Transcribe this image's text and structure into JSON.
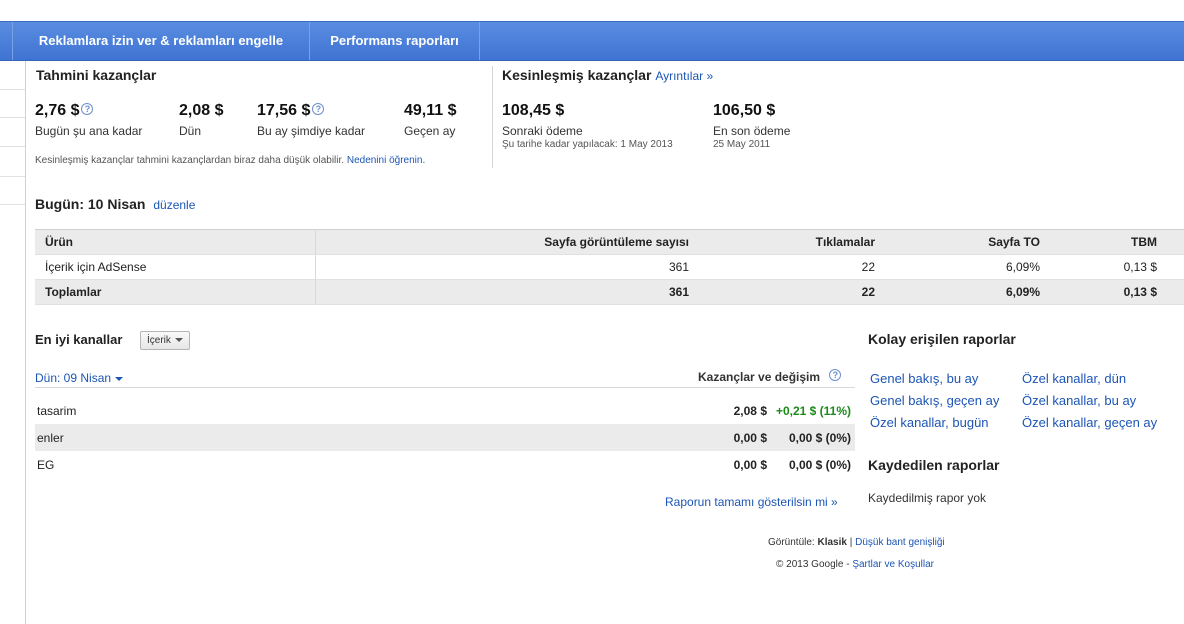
{
  "nav": {
    "tab1": "Reklamlara izin ver & reklamları engelle",
    "tab2": "Performans raporları"
  },
  "estimated": {
    "title": "Tahmini kazançlar",
    "items": [
      {
        "value": "2,76 $",
        "label": "Bugün şu ana kadar"
      },
      {
        "value": "2,08 $",
        "label": "Dün"
      },
      {
        "value": "17,56 $",
        "label": "Bu ay şimdiye kadar"
      },
      {
        "value": "49,11 $",
        "label": "Geçen ay"
      }
    ],
    "note": "Kesinleşmiş kazançlar tahmini kazançlardan biraz daha düşük olabilir.",
    "note_link": "Nedenini öğrenin."
  },
  "finalized": {
    "title": "Kesinleşmiş kazançlar",
    "details_link": "Ayrıntılar »",
    "next": {
      "value": "108,45 $",
      "label": "Sonraki ödeme",
      "note": "Şu tarihe kadar yapılacak: 1 May 2013"
    },
    "last": {
      "value": "106,50 $",
      "label": "En son ödeme",
      "note": "25 May 2011"
    }
  },
  "today": {
    "title": "Bugün: 10 Nisan",
    "edit_link": "düzenle"
  },
  "table": {
    "headers": [
      "Ürün",
      "Sayfa görüntüleme sayısı",
      "Tıklamalar",
      "Sayfa TO",
      "TBM"
    ],
    "rows": [
      [
        "İçerik için AdSense",
        "361",
        "22",
        "6,09%",
        "0,13 $"
      ]
    ],
    "totals": [
      "Toplamlar",
      "361",
      "22",
      "6,09%",
      "0,13 $"
    ]
  },
  "channels": {
    "title": "En iyi kanallar",
    "dropdown": "İçerik",
    "date_link": "Dün: 09 Nisan",
    "column_header": "Kazançlar ve değişim",
    "rows": [
      {
        "name": "tasarim",
        "amount": "2,08 $",
        "change": "+0,21 $ (11%)"
      },
      {
        "name": "enler",
        "amount": "0,00 $",
        "change": "0,00 $ (0%)"
      },
      {
        "name": "EG",
        "amount": "0,00 $",
        "change": "0,00 $ (0%)"
      }
    ],
    "full_report_link": "Raporun tamamı gösterilsin mi »"
  },
  "quick_reports": {
    "title": "Kolay erişilen raporlar",
    "links": [
      "Genel bakış, bu ay",
      "Özel kanallar, dün",
      "Genel bakış, geçen ay",
      "Özel kanallar, bu ay",
      "Özel kanallar, bugün",
      "Özel kanallar, geçen ay"
    ]
  },
  "saved_reports": {
    "title": "Kaydedilen raporlar",
    "empty": "Kaydedilmiş rapor yok"
  },
  "footer": {
    "view_label": "Görüntüle:",
    "view_current": "Klasik",
    "separator": "|",
    "view_alt": "Düşük bant genişliği",
    "copyright": "© 2013 Google -",
    "terms": "Şartlar ve Koşullar"
  },
  "colors": {
    "nav": "#4a7fdb",
    "link": "#1c55b5",
    "positive": "#1a8a1a"
  }
}
